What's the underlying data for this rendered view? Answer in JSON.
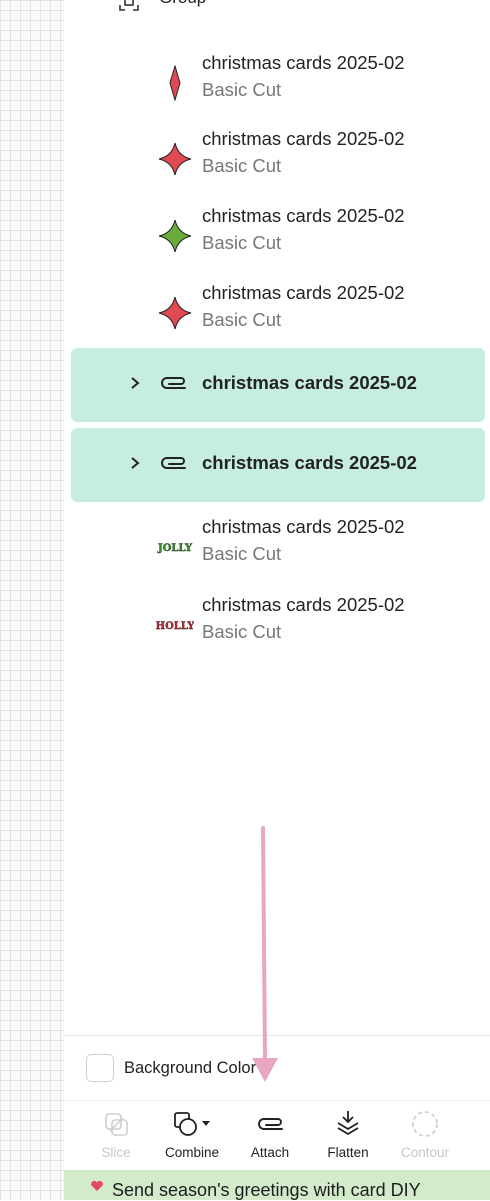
{
  "group_header": {
    "label": "Group"
  },
  "layers": [
    {
      "name": "christmas cards 2025-02",
      "subtitle": "Basic Cut",
      "thumbnail": "thin-diamond-red"
    },
    {
      "name": "christmas cards 2025-02",
      "subtitle": "Basic Cut",
      "thumbnail": "star-diamond-red"
    },
    {
      "name": "christmas cards 2025-02",
      "subtitle": "Basic Cut",
      "thumbnail": "star-diamond-green"
    },
    {
      "name": "christmas cards 2025-02",
      "subtitle": "Basic Cut",
      "thumbnail": "star-diamond-red"
    }
  ],
  "attached_groups": [
    {
      "name": "christmas cards 2025-02",
      "icon": "paperclip-icon",
      "expander": "chevron-right-icon"
    },
    {
      "name": "christmas cards 2025-02",
      "icon": "paperclip-icon",
      "expander": "chevron-right-icon"
    }
  ],
  "text_layers": [
    {
      "name": "christmas cards 2025-02",
      "subtitle": "Basic Cut",
      "thumbnail_text": "JOLLY",
      "thumbnail_color": "#3d8a2e"
    },
    {
      "name": "christmas cards 2025-02",
      "subtitle": "Basic Cut",
      "thumbnail_text": "HOLLY",
      "thumbnail_color": "#b8303a"
    }
  ],
  "background_color": {
    "label": "Background Color",
    "checked": false
  },
  "toolbar": {
    "slice": {
      "label": "Slice",
      "enabled": false
    },
    "combine": {
      "label": "Combine",
      "enabled": true
    },
    "attach": {
      "label": "Attach",
      "enabled": true
    },
    "flatten": {
      "label": "Flatten",
      "enabled": true
    },
    "contour": {
      "label": "Contour",
      "enabled": false
    }
  },
  "banner": {
    "text": "Send season's greetings with card DIY"
  },
  "colors": {
    "selected_row": "#c7ede0",
    "banner_bg": "#d3ebcb",
    "shape_red": "#e04a52",
    "shape_green": "#6aab3c",
    "annotation_arrow": "#e8a5c4"
  }
}
